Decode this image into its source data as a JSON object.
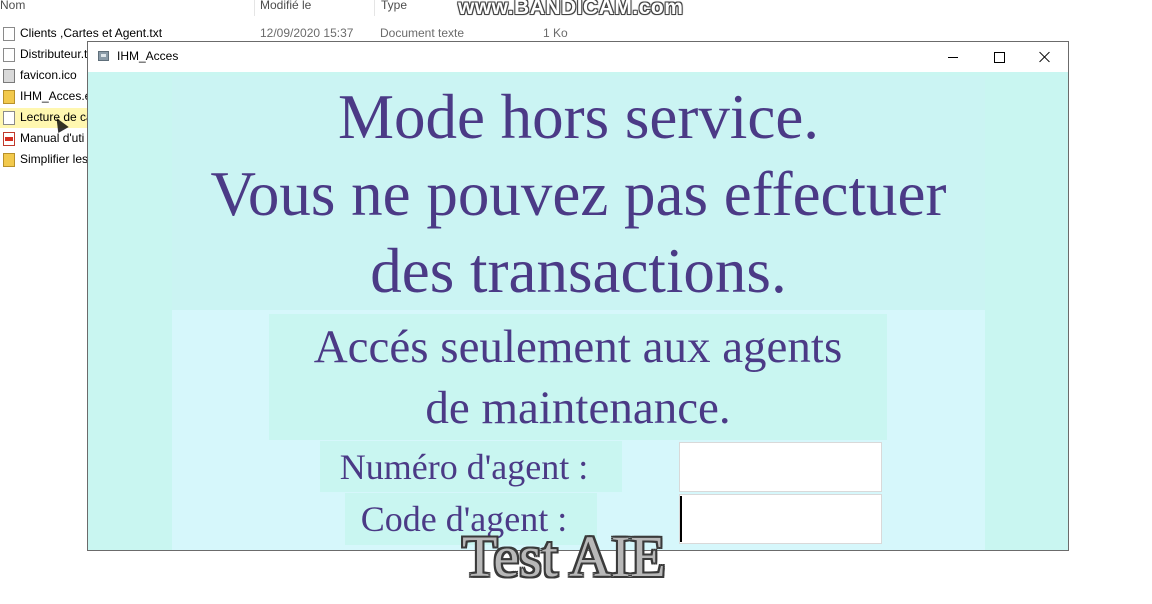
{
  "explorer": {
    "columns": {
      "name": "Nom",
      "modified": "Modifié le",
      "type": "Type"
    },
    "files": [
      {
        "name": "Clients ,Cartes et Agent.txt",
        "date": "12/09/2020 15:37",
        "type": "Document texte",
        "size": "1 Ko",
        "icon": "text-file-icon"
      },
      {
        "name": "Distributeur.t",
        "date": "",
        "type": "",
        "size": "",
        "icon": "text-file-icon"
      },
      {
        "name": "favicon.ico",
        "date": "",
        "type": "",
        "size": "",
        "icon": "ico-file-icon"
      },
      {
        "name": "IHM_Acces.e",
        "date": "",
        "type": "",
        "size": "",
        "icon": "exe-file-icon"
      },
      {
        "name": "Lecture de ca",
        "date": "",
        "type": "",
        "size": "",
        "icon": "text-file-icon"
      },
      {
        "name": "Manual d'uti",
        "date": "",
        "type": "",
        "size": "",
        "icon": "pdf-file-icon"
      },
      {
        "name": "Simplifier les",
        "date": "",
        "type": "",
        "size": "",
        "icon": "shortcut-file-icon"
      }
    ]
  },
  "watermark": "www.BANDICAM.com",
  "window": {
    "title": "IHM_Acces",
    "controls": {
      "minimize": "minimize-icon",
      "maximize": "maximize-icon",
      "close": "close-icon"
    }
  },
  "screen": {
    "out_of_service_lines": [
      "Mode hors service.",
      "Vous ne pouvez pas effectuer",
      "des transactions."
    ],
    "access_lines": [
      "Accés seulement aux agents",
      "de maintenance."
    ],
    "agent_number_label": "Numéro d'agent :",
    "agent_code_label": "Code d'agent :",
    "agent_number_value": "",
    "agent_code_value": ""
  },
  "caption": "Test AIE",
  "colors": {
    "text": "#4b3a86",
    "background": "#c9f6f1"
  }
}
